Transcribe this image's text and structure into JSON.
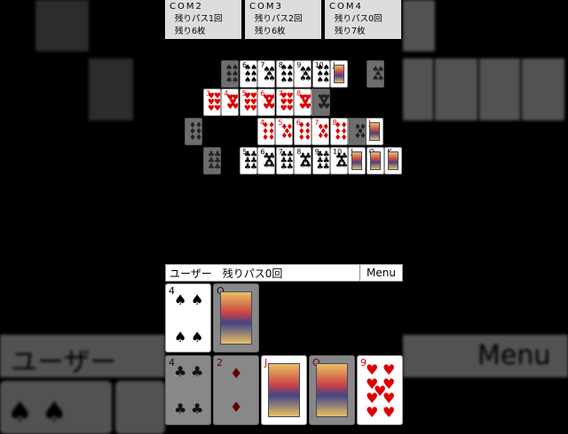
{
  "players": [
    {
      "name": "COM2",
      "passes": "残りパス1回",
      "cards": "残り6枚"
    },
    {
      "name": "COM3",
      "passes": "残りパス2回",
      "cards": "残り6枚"
    },
    {
      "name": "COM4",
      "passes": "残りパス0回",
      "cards": "残り7枚"
    }
  ],
  "user": {
    "label": "ユーザー　残りパス0回",
    "menu": "Menu"
  },
  "background": {
    "user_label": "ユーザー",
    "menu_label": "Menu"
  },
  "board": {
    "rows": [
      {
        "suit": "spade",
        "ranks": [
          "6",
          "7",
          "8",
          "9",
          "10",
          "J"
        ]
      },
      {
        "suit": "heart",
        "ranks": [
          "3",
          "4",
          "5",
          "6",
          "7",
          "8",
          "9"
        ]
      },
      {
        "suit": "diamond",
        "ranks": [
          "4",
          "5",
          "6",
          "7",
          "8",
          "9",
          "J"
        ]
      },
      {
        "suit": "club",
        "ranks": [
          "5",
          "6",
          "7",
          "8",
          "9",
          "10",
          "J",
          "Q",
          "K"
        ]
      }
    ]
  },
  "hand": [
    {
      "rank": "4",
      "suit": "spade",
      "playable": true
    },
    {
      "rank": "Q",
      "suit": "spade",
      "playable": false
    },
    {
      "rank": "4",
      "suit": "club",
      "playable": false
    },
    {
      "rank": "2",
      "suit": "diamond",
      "playable": false
    },
    {
      "rank": "J",
      "suit": "diamond",
      "playable": true
    },
    {
      "rank": "Q",
      "suit": "heart",
      "playable": false
    },
    {
      "rank": "9",
      "suit": "heart",
      "playable": true
    }
  ],
  "colors": {
    "red_suit": "#d00",
    "black_suit": "#000",
    "panel": "#ddd",
    "table": "#000"
  }
}
